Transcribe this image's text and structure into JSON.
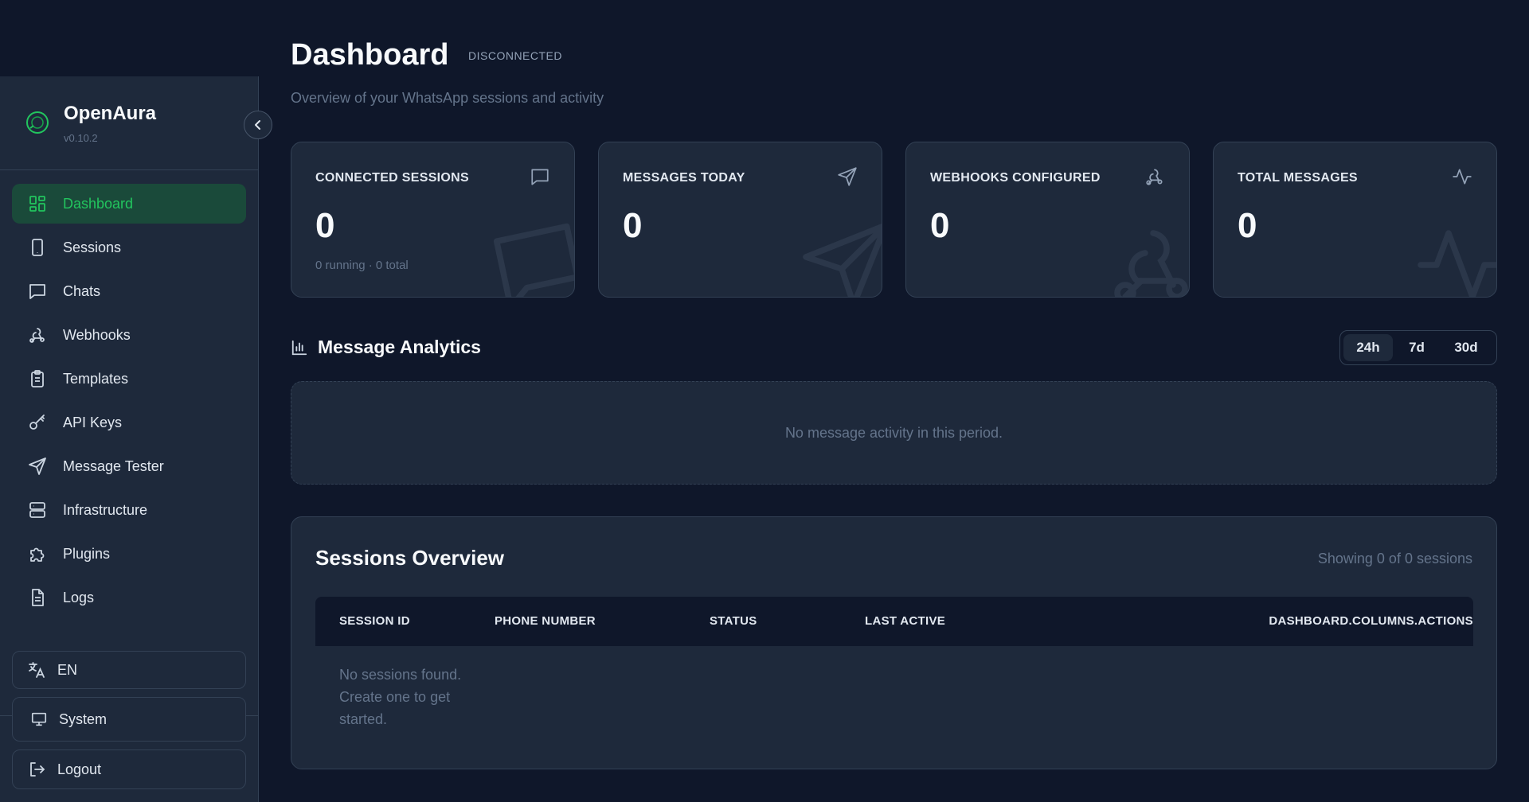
{
  "brand": {
    "name": "OpenAura",
    "version": "v0.10.2"
  },
  "nav": {
    "items": [
      {
        "label": "Dashboard",
        "icon": "grid-icon",
        "active": true
      },
      {
        "label": "Sessions",
        "icon": "phone-icon"
      },
      {
        "label": "Chats",
        "icon": "chat-icon"
      },
      {
        "label": "Webhooks",
        "icon": "webhook-icon"
      },
      {
        "label": "Templates",
        "icon": "clipboard-icon"
      },
      {
        "label": "API Keys",
        "icon": "key-icon"
      },
      {
        "label": "Message Tester",
        "icon": "send-icon"
      },
      {
        "label": "Infrastructure",
        "icon": "server-icon"
      },
      {
        "label": "Plugins",
        "icon": "puzzle-icon"
      },
      {
        "label": "Logs",
        "icon": "file-icon"
      }
    ]
  },
  "footer": {
    "language": "EN",
    "theme": "System",
    "logout": "Logout"
  },
  "header": {
    "title": "Dashboard",
    "status": "DISCONNECTED",
    "subtitle": "Overview of your WhatsApp sessions and activity"
  },
  "stats": [
    {
      "label": "CONNECTED SESSIONS",
      "value": "0",
      "sub": "0 running · 0 total",
      "icon": "chat-icon"
    },
    {
      "label": "MESSAGES TODAY",
      "value": "0",
      "sub": "",
      "icon": "send-icon"
    },
    {
      "label": "WEBHOOKS CONFIGURED",
      "value": "0",
      "sub": "",
      "icon": "webhook-icon"
    },
    {
      "label": "TOTAL MESSAGES",
      "value": "0",
      "sub": "",
      "icon": "activity-icon"
    }
  ],
  "analytics": {
    "title": "Message Analytics",
    "ranges": [
      "24h",
      "7d",
      "30d"
    ],
    "selected_range": "24h",
    "empty": "No message activity in this period."
  },
  "sessions": {
    "title": "Sessions Overview",
    "count": "Showing 0 of 0 sessions",
    "columns": [
      "SESSION ID",
      "PHONE NUMBER",
      "STATUS",
      "LAST ACTIVE",
      "DASHBOARD.COLUMNS.ACTIONS"
    ],
    "empty": "No sessions found. Create one to get started."
  },
  "colors": {
    "accent": "#22c55e",
    "active_bg": "#1a4a3a",
    "background": "#0f172a",
    "panel": "#1e293b"
  }
}
